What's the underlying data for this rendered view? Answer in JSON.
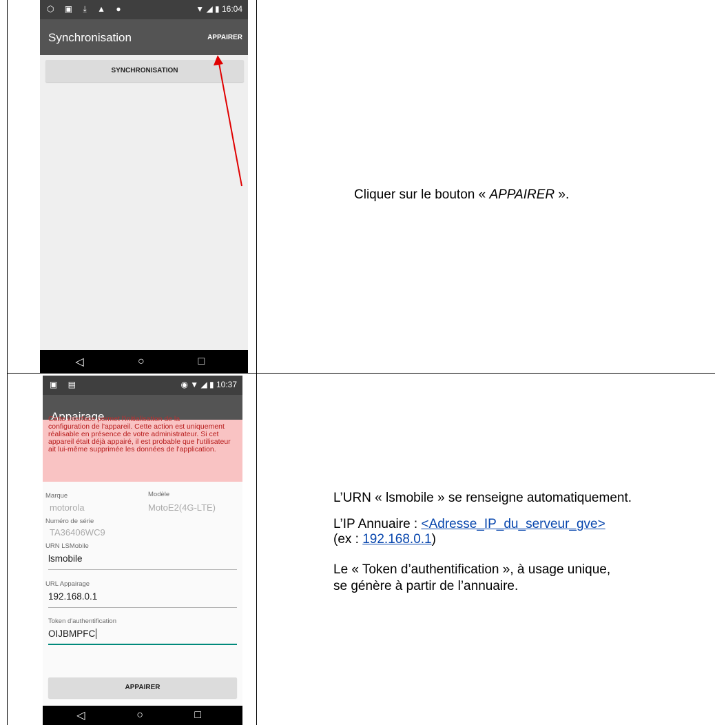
{
  "step1": {
    "status_icons_left": "⬡ ▣ ⤓ ▲ ●",
    "status_icons_right": "▼ ◢ ▮",
    "status_time": "16:04",
    "title": "Synchronisation",
    "action": "APPAIRER",
    "button": "SYNCHRONISATION",
    "instruction": {
      "prefix": "Cliquer sur le bouton « ",
      "em": "APPAIRER",
      "suffix": " »."
    },
    "annotation_color": "#e00000"
  },
  "step2": {
    "status_icons_left": "▣ ▤",
    "status_icons_right": "◉ ▼ ◢ ▮",
    "status_time": "10:37",
    "title": "Appairage",
    "warning_cut": "Cette interface permet l'initialisation de la",
    "warning": "configuration de l'appareil. Cette action est uniquement réalisable en présence de votre administrateur. Si cet appareil était déjà appairé, il est probable que l'utilisateur ait lui-même supprimée les données de l'application.",
    "fields": {
      "marque_label": "Marque",
      "marque_value": "motorola",
      "modele_label": "Modèle",
      "modele_value": "MotoE2(4G-LTE)",
      "serie_label": "Numéro de série",
      "serie_value": "TA36406WC9",
      "urn_label": "URN LSMobile",
      "urn_value": "lsmobile",
      "url_label": "URL Appairage",
      "url_value": "192.168.0.1",
      "token_label": "Token d'authentification",
      "token_value": "OIJBMPFC"
    },
    "button": "APPAIRER",
    "text": {
      "urn_line": "L’URN « lsmobile » se renseigne automatiquement.",
      "ip_prefix": "L’IP Annuaire : ",
      "ip_link": "<Adresse_IP_du_serveur_gve>",
      "ex_prefix": "(ex : ",
      "ex_link": "192.168.0.1",
      "ex_suffix": ")",
      "token_line1": "Le « Token d’authentification », à usage unique,",
      "token_line2": "se génère à partir de l’annuaire."
    }
  },
  "colors": {
    "appbar": "#545454",
    "statusbar": "#3f3f3f",
    "warning_bg": "#f9c3c3",
    "warning_text": "#b71c1c",
    "link": "#0645ad",
    "focus_underline": "#00897b"
  }
}
